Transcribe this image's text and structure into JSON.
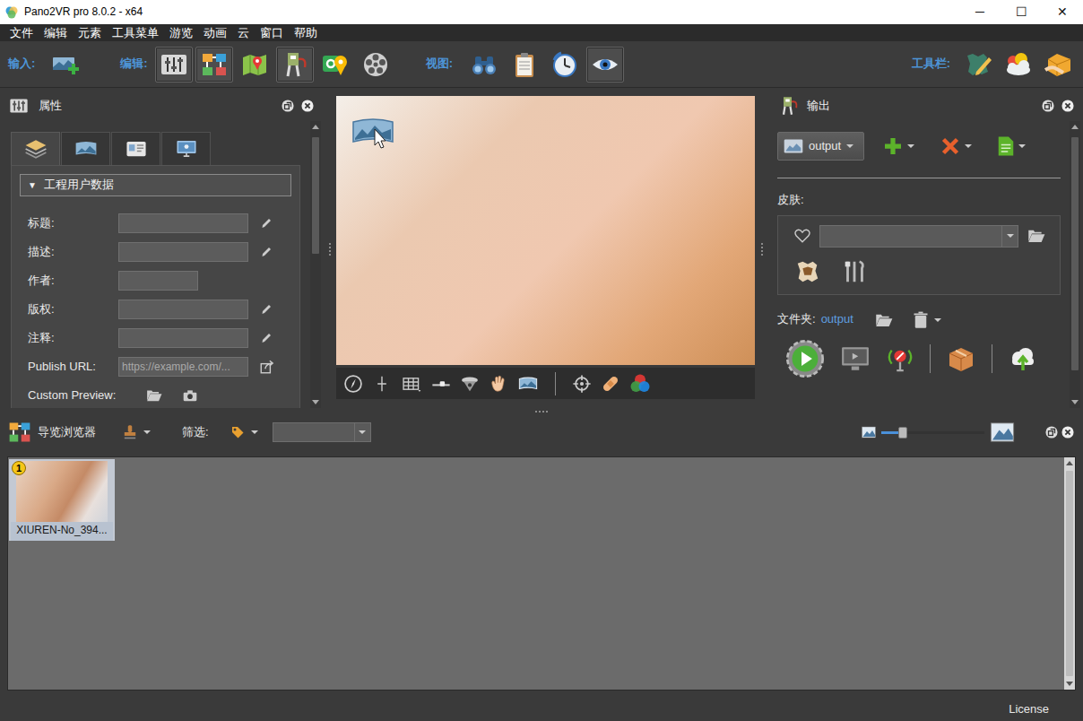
{
  "window": {
    "title": "Pano2VR pro 8.0.2 - x64",
    "controls": [
      "─",
      "☐",
      "✕"
    ]
  },
  "menu": [
    "文件",
    "编辑",
    "元素",
    "工具菜单",
    "游览",
    "动画",
    "云",
    "窗口",
    "帮助"
  ],
  "toolbar": {
    "input": {
      "label": "输入:",
      "buttons": [
        {
          "selected": false
        }
      ]
    },
    "edit": {
      "label": "编辑:",
      "buttons": [
        {
          "selected": true
        },
        {
          "selected": true
        },
        {
          "selected": false
        },
        {
          "selected": true
        },
        {
          "selected": false
        },
        {
          "selected": false
        }
      ]
    },
    "view": {
      "label": "视图:",
      "buttons": [
        {
          "selected": false
        },
        {
          "selected": false
        },
        {
          "selected": false
        },
        {
          "selected": true
        }
      ]
    },
    "toolbars": {
      "label": "工具栏:",
      "buttons": [
        {
          "selected": false
        },
        {
          "selected": false
        },
        {
          "selected": false
        }
      ]
    }
  },
  "properties": {
    "title": "属性",
    "tabs": [
      {
        "selected": true
      },
      {
        "selected": false
      },
      {
        "selected": false
      },
      {
        "selected": false
      }
    ],
    "section": {
      "arrow": "▼",
      "label": "工程用户数据",
      "expanded": true
    },
    "fields": [
      {
        "label": "标题:",
        "kind": "edit"
      },
      {
        "label": "描述:",
        "kind": "edit"
      },
      {
        "label": "作者:",
        "kind": "plain"
      },
      {
        "label": "版权:",
        "kind": "edit"
      },
      {
        "label": "注释:",
        "kind": "edit"
      },
      {
        "label": "Publish URL:",
        "kind": "link",
        "placeholder": "https://example.com/..."
      },
      {
        "label": "Custom Preview:",
        "kind": "preview"
      }
    ]
  },
  "output": {
    "title": "输出",
    "preset": "output",
    "skin_label": "皮肤:",
    "favorite": false,
    "folder_label": "文件夹:",
    "folder": "output"
  },
  "navigator": {
    "title": "导览浏览器",
    "filter_label": "筛选:",
    "zoom": 0.21,
    "nodes": [
      {
        "label": "XIUREN-No_394...",
        "badge": "1",
        "selected": true
      }
    ]
  },
  "status_bar": {
    "license": "License"
  }
}
